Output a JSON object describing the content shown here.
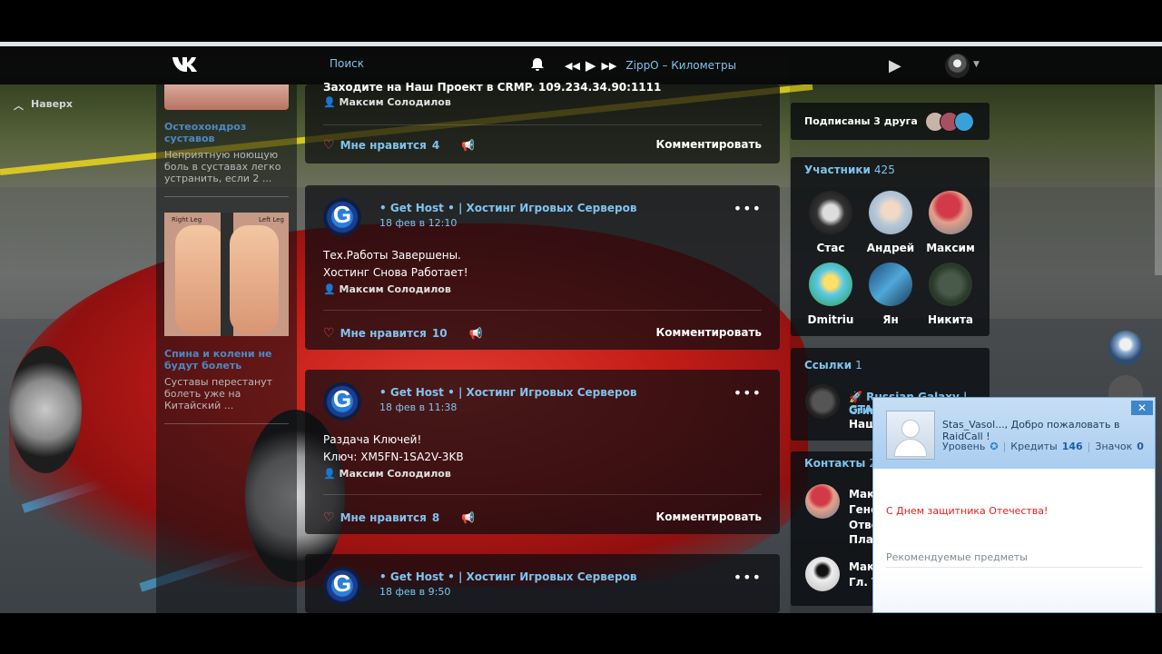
{
  "nav": {
    "search": "Поиск",
    "track": "ZippO – Километры",
    "scroll_top": "Наверх"
  },
  "ads": [
    {
      "title": "Остеохондроз суставов",
      "text": "Неприятную ноющую боль в суставах легко устранить, если 2 ..."
    },
    {
      "title": "Спина и колени не будут болеть",
      "text": "Суставы перестанут болеть уже на Китайский ..."
    }
  ],
  "ad_image_labels": {
    "left": "Right Leg",
    "right": "Left Leg"
  },
  "posts": [
    {
      "partial_text": "Заходите на Наш Проект в CRMP. 109.234.34.90:1111",
      "signer": "Максим Солодилов",
      "like_label": "Мне нравится",
      "likes": "4",
      "comment_label": "Комментировать"
    },
    {
      "author": "• Get Host • | Хостинг Игровых Серверов",
      "date": "18 фев в 12:10",
      "line1": "Тех.Работы Завершены.",
      "line2": "Хостинг Снова Работает!",
      "signer": "Максим Солодилов",
      "like_label": "Мне нравится",
      "likes": "10",
      "comment_label": "Комментировать"
    },
    {
      "author": "• Get Host • | Хостинг Игровых Серверов",
      "date": "18 фев в 11:38",
      "line1": "Раздача Ключей!",
      "line2": "Ключ: XM5FN-1SA2V-3KB",
      "signer": "Максим Солодилов",
      "like_label": "Мне нравится",
      "likes": "8",
      "comment_label": "Комментировать"
    },
    {
      "author": "• Get Host • | Хостинг Игровых Серверов",
      "date": "18 фев в 9:50"
    }
  ],
  "sidebar": {
    "subscribed": "Подписаны 3 друга",
    "members_title": "Участники",
    "members_count": "425",
    "members": [
      "Стас",
      "Андрей",
      "Максим",
      "Dmitriu",
      "Ян",
      "Никита"
    ],
    "links_title": "Ссылки",
    "links_count": "1",
    "link_name": "Russian Galaxy | GTA",
    "link_sub": "Crim",
    "link_sub2": "Наш",
    "contacts_title": "Контакты",
    "contacts_count": "2",
    "contact1": [
      "Макс",
      "Генер",
      "Отве",
      "Плат"
    ],
    "contact2": [
      "Макс",
      "Гл. Те"
    ]
  },
  "raidcall": {
    "welcome": "Stas_Vasol..., Добро пожаловать в RaidCall !",
    "level_label": "Уровень",
    "credits_label": "Кредиты",
    "credits": "146",
    "badge_label": "Значок",
    "badge": "0",
    "greeting": "С Днем защитника Отечества!",
    "recommended": "Рекомендуемые предметы",
    "close": "✕"
  },
  "colors": {
    "accent": "#7fc3ee",
    "heart": "#e35b5b",
    "greeting_red": "#e02020"
  }
}
